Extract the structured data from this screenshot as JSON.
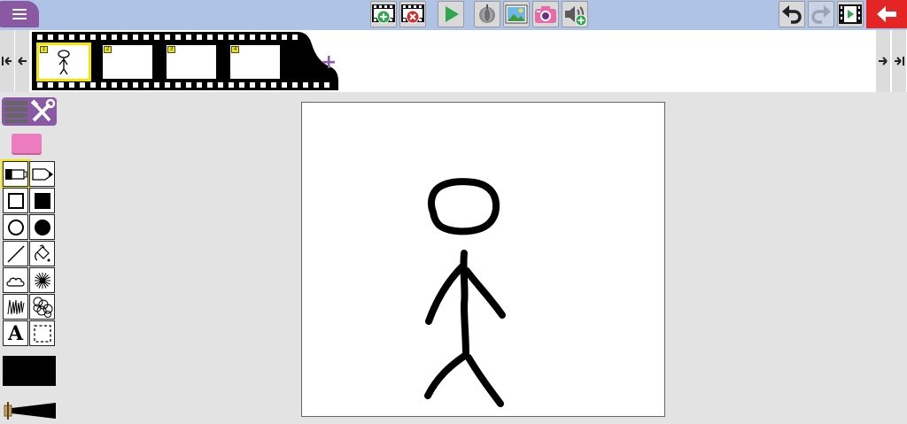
{
  "toolbar": {
    "buttons": [
      {
        "name": "menu-button",
        "icon": "menu-icon"
      },
      {
        "name": "add-frame-button",
        "icon": "film-add-icon"
      },
      {
        "name": "delete-frame-button",
        "icon": "film-delete-icon"
      },
      {
        "name": "play-button",
        "icon": "play-icon"
      },
      {
        "name": "onion-skin-button",
        "icon": "onion-skin-icon"
      },
      {
        "name": "background-image-button",
        "icon": "image-icon"
      },
      {
        "name": "camera-button",
        "icon": "camera-icon"
      },
      {
        "name": "add-sound-button",
        "icon": "speaker-add-icon"
      },
      {
        "name": "undo-button",
        "icon": "undo-icon"
      },
      {
        "name": "redo-button",
        "icon": "redo-icon"
      },
      {
        "name": "export-movie-button",
        "icon": "film-play-icon"
      },
      {
        "name": "back-button",
        "icon": "back-arrow-icon"
      }
    ],
    "colors": {
      "bar": "#aec3e5",
      "menu": "#8a59a3",
      "back": "#e32526",
      "play": "#2aa84a"
    }
  },
  "filmstrip": {
    "frames": [
      {
        "number": "1",
        "selected": true,
        "has_drawing": true
      },
      {
        "number": "2",
        "selected": false,
        "has_drawing": false
      },
      {
        "number": "3",
        "selected": false,
        "has_drawing": false
      },
      {
        "number": "4",
        "selected": false,
        "has_drawing": false
      }
    ],
    "add_label": "+"
  },
  "tools": {
    "text_tool_label": "A",
    "items": [
      "tool-settings-icon",
      "eraser-icon",
      "brush-marker-icon",
      "pen-icon",
      "rectangle-outline-icon",
      "rectangle-filled-icon",
      "circle-outline-icon",
      "circle-filled-icon",
      "line-icon",
      "fill-bucket-icon",
      "cloud-shape-icon",
      "spray-icon",
      "scribble-icon",
      "stamp-circles-icon",
      "text-icon",
      "selection-icon"
    ],
    "current_color": "#000000",
    "highlight_color": "#f2e600"
  }
}
